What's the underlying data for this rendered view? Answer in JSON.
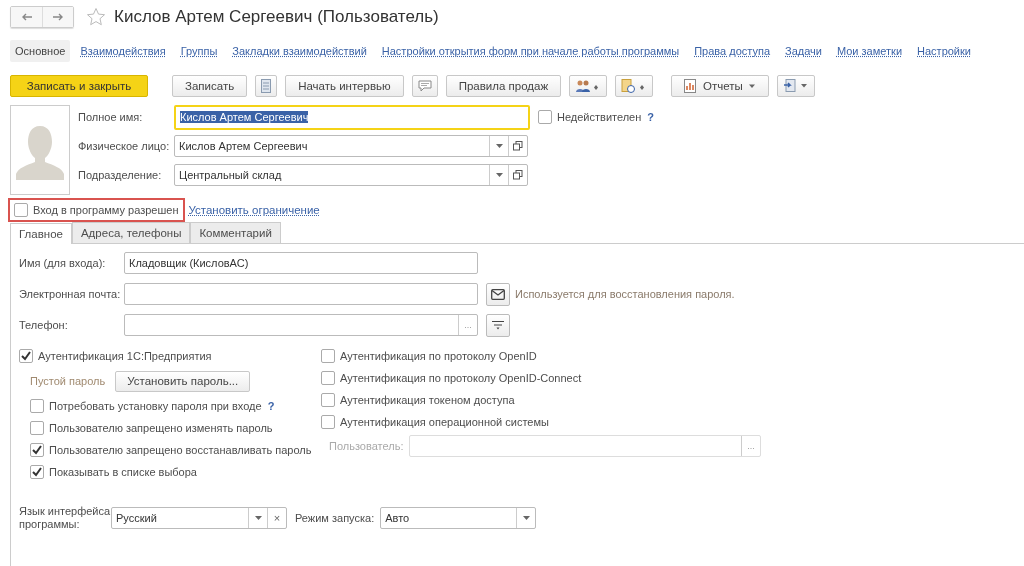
{
  "window": {
    "title": "Кислов Артем Сергеевич (Пользователь)",
    "favorite": false
  },
  "sections": [
    {
      "label": "Основное",
      "selected": true
    },
    {
      "label": "Взаимодействия",
      "selected": false
    },
    {
      "label": "Группы",
      "selected": false
    },
    {
      "label": "Закладки взаимодействий",
      "selected": false
    },
    {
      "label": "Настройки открытия форм при начале работы программы",
      "selected": false
    },
    {
      "label": "Права доступа",
      "selected": false
    },
    {
      "label": "Задачи",
      "selected": false
    },
    {
      "label": "Мои заметки",
      "selected": false
    },
    {
      "label": "Настройки",
      "selected": false
    }
  ],
  "toolbar": {
    "save_close": "Записать и закрыть",
    "save": "Записать",
    "interview": "Начать интервью",
    "sales_rules": "Правила продаж",
    "reports": "Отчеты"
  },
  "full_name": {
    "label": "Полное имя:",
    "value": "Кислов Артем Сергеевич",
    "text_selected": true
  },
  "person": {
    "label": "Физическое лицо:",
    "value": "Кислов Артем Сергеевич"
  },
  "department": {
    "label": "Подразделение:",
    "value": "Центральный склад"
  },
  "inactive": {
    "label": "Недействителен",
    "checked": false,
    "help": "?"
  },
  "login_allowed": {
    "label": "Вход в программу разрешен",
    "checked": false,
    "highlighted": true
  },
  "set_restriction": "Установить ограничение",
  "tabs": [
    {
      "label": "Главное",
      "selected": true
    },
    {
      "label": "Адреса, телефоны",
      "selected": false
    },
    {
      "label": "Комментарий",
      "selected": false
    }
  ],
  "login_name": {
    "label": "Имя (для входа):",
    "value": "Кладовщик (КисловАС)"
  },
  "email": {
    "label": "Электронная почта:",
    "hint": "Используется для восстановления пароля."
  },
  "phone": {
    "label": "Телефон:",
    "choice": "..."
  },
  "auth_1c": {
    "label": "Аутентификация 1С:Предприятия",
    "checked": true
  },
  "empty_password": "Пустой пароль",
  "set_password": "Установить пароль...",
  "left_checks": [
    {
      "label": "Потребовать установку пароля при входе",
      "checked": false,
      "help": "?"
    },
    {
      "label": "Пользователю запрещено изменять пароль",
      "checked": false
    },
    {
      "label": "Пользователю запрещено восстанавливать пароль",
      "checked": true
    },
    {
      "label": "Показывать в списке выбора",
      "checked": true
    }
  ],
  "right_checks": [
    {
      "label": "Аутентификация по протоколу OpenID",
      "checked": false
    },
    {
      "label": "Аутентификация по протоколу OpenID-Connect",
      "checked": false
    },
    {
      "label": "Аутентификация токеном доступа",
      "checked": false
    },
    {
      "label": "Аутентификация операционной системы",
      "checked": false
    }
  ],
  "os_user": {
    "label": "Пользователь:",
    "disabled": true,
    "choice": "..."
  },
  "language": {
    "label": "Язык интерфейса программы:",
    "value": "Русский",
    "clear": "×"
  },
  "run_mode": {
    "label": "Режим запуска:",
    "value": "Авто"
  }
}
